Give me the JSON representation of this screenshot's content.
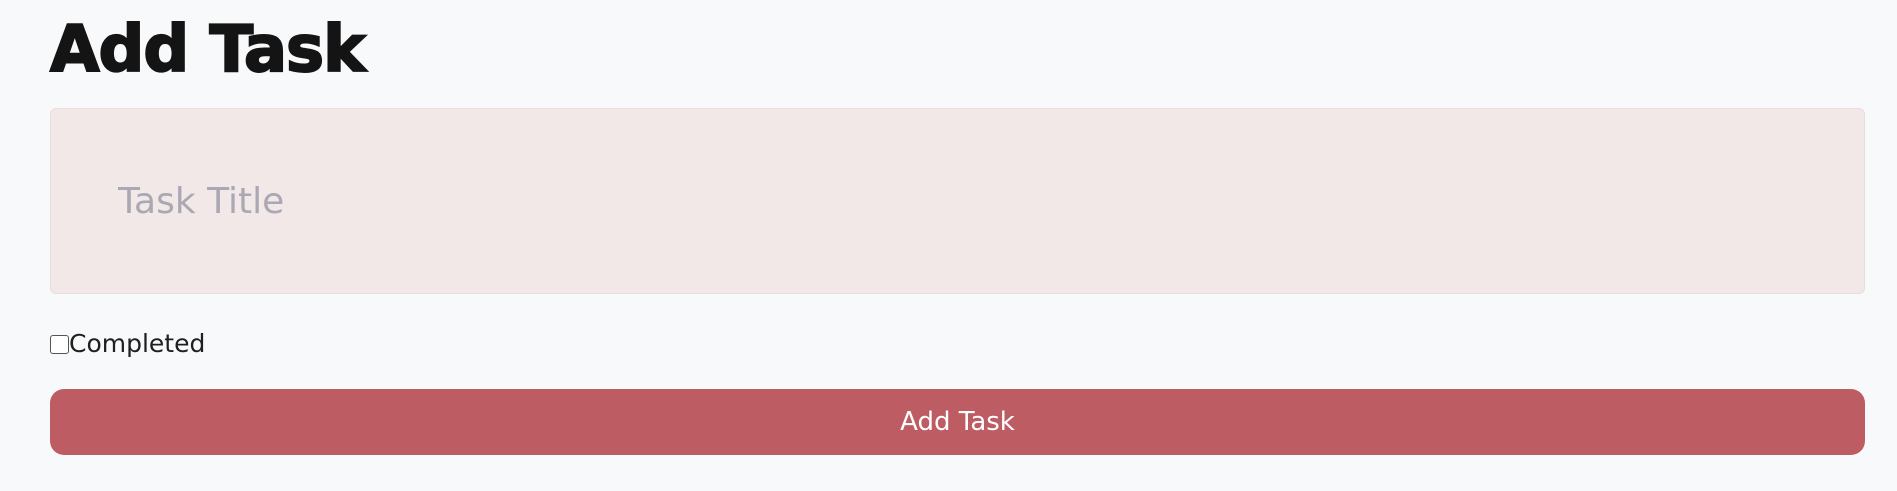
{
  "form": {
    "heading": "Add Task",
    "title_input": {
      "placeholder": "Task Title",
      "value": ""
    },
    "completed_checkbox": {
      "label": "Completed",
      "checked": false
    },
    "submit_label": "Add Task"
  },
  "colors": {
    "page_background": "#f8f9fb",
    "input_background": "#f3e8e8",
    "placeholder_text": "#a9a8b3",
    "button_background": "#bd5c63",
    "button_text": "#ffffff",
    "heading_text": "#141414"
  }
}
